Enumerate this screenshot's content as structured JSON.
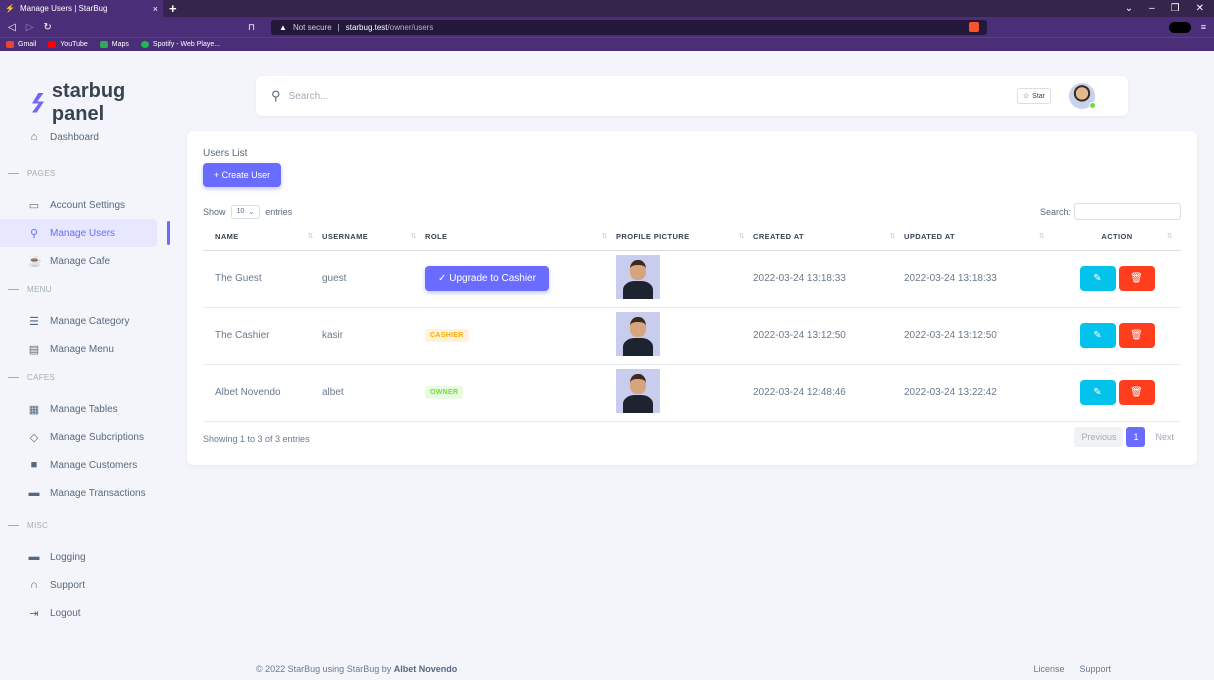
{
  "browser": {
    "tab_title": "Manage Users | StarBug",
    "tab_close": "×",
    "new_tab": "+",
    "url_warning": "Not secure",
    "url_host": "starbug.test",
    "url_path": "/owner/users",
    "bookmarks": [
      {
        "label": "Gmail",
        "color": "#ea4335"
      },
      {
        "label": "YouTube",
        "color": "#ff0000"
      },
      {
        "label": "Maps",
        "color": "#34a853"
      },
      {
        "label": "Spotify - Web Playe...",
        "color": "#1db954"
      }
    ]
  },
  "brand": {
    "name": "starbug panel",
    "accent": "#696cff"
  },
  "sidebar": {
    "dashboard": "Dashboard",
    "sections": {
      "pages": "PAGES",
      "menu": "MENU",
      "cafes": "CAFES",
      "misc": "MISC"
    },
    "items": {
      "account_settings": "Account Settings",
      "manage_users": "Manage Users",
      "manage_cafe": "Manage Cafe",
      "manage_category": "Manage Category",
      "manage_menu": "Manage Menu",
      "manage_tables": "Manage Tables",
      "manage_subscriptions": "Manage Subcriptions",
      "manage_customers": "Manage Customers",
      "manage_transactions": "Manage Transactions",
      "logging": "Logging",
      "support": "Support",
      "logout": "Logout"
    },
    "active": "Manage Users"
  },
  "topbar": {
    "search_placeholder": "Search...",
    "star_label": "Star"
  },
  "card": {
    "title": "Users List",
    "create_button": "+ Create User",
    "show_label": "Show",
    "entries_value": "10",
    "entries_label": "entries",
    "search_label": "Search:",
    "columns": [
      "NAME",
      "USERNAME",
      "ROLE",
      "PROFILE PICTURE",
      "CREATED AT",
      "UPDATED AT",
      "ACTION"
    ],
    "rows": [
      {
        "name": "The Guest",
        "username": "guest",
        "role": "Upgrade to Cashier",
        "created_at": "2022-03-24 13:18:33",
        "updated_at": "2022-03-24 13:18:33"
      },
      {
        "name": "The Cashier",
        "username": "kasir",
        "role": "CASHIER",
        "created_at": "2022-03-24 13:12:50",
        "updated_at": "2022-03-24 13:12:50"
      },
      {
        "name": "Albet Novendo",
        "username": "albet",
        "role": "OWNER",
        "created_at": "2022-03-24 12:48:46",
        "updated_at": "2022-03-24 13:22:42"
      }
    ],
    "info": "Showing 1 to 3 of 3 entries",
    "pager": {
      "previous": "Previous",
      "current": "1",
      "next": "Next"
    }
  },
  "footer": {
    "copyright": "© 2022 StarBug using StarBug by",
    "author": "Albet Novendo",
    "links": [
      "License",
      "Support"
    ]
  }
}
